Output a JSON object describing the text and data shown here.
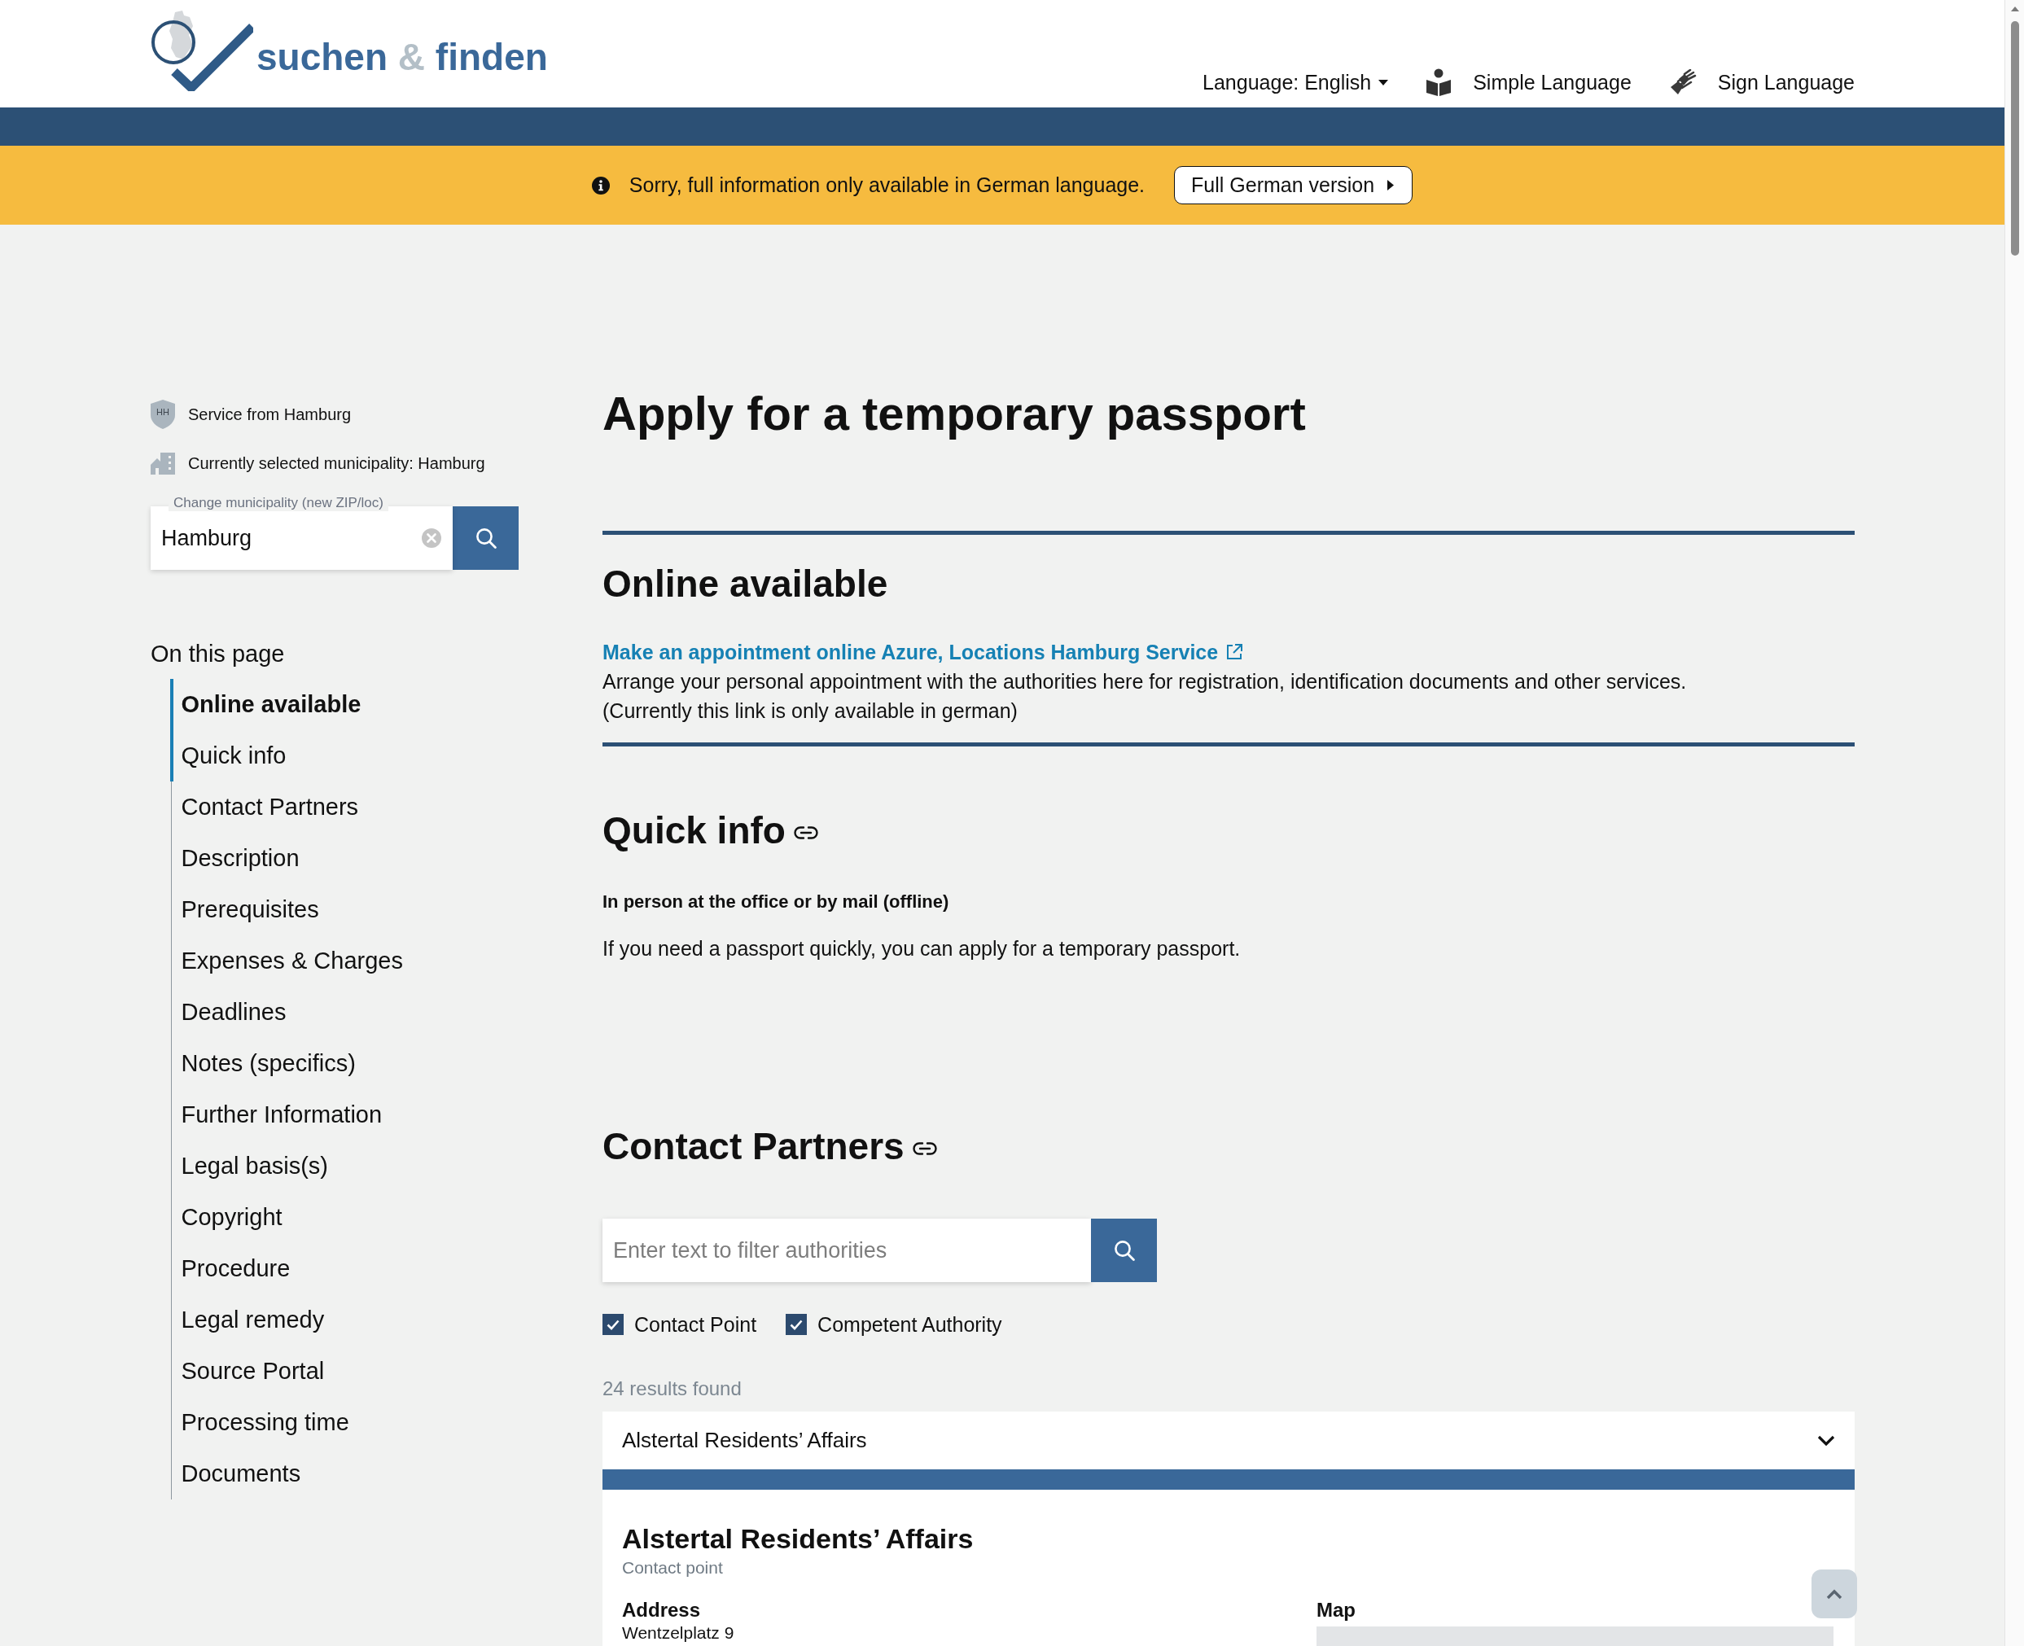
{
  "header": {
    "logo": [
      {
        "text": "suchen",
        "kind": "word"
      },
      {
        "text": "&",
        "kind": "joiner"
      },
      {
        "text": "finden",
        "kind": "word"
      }
    ],
    "language_menu": "Language: English",
    "links": [
      {
        "label": "Simple Language",
        "kind": "simple"
      },
      {
        "label": "Sign Language",
        "kind": "sign"
      }
    ]
  },
  "notice": {
    "text": "Sorry, full information only available in German language.",
    "button": "Full German version"
  },
  "sidebar": {
    "service": {
      "badge": "HH",
      "text": "Service from Hamburg"
    },
    "municipality": "Currently selected municipality: Hamburg",
    "municipality_field": {
      "label": "Change municipality (new ZIP/loc)",
      "value": "Hamburg"
    },
    "toc": {
      "title": "On this page",
      "items": [
        {
          "label": "Online available",
          "selected": true,
          "in_view": true
        },
        {
          "label": "Quick info",
          "selected": false,
          "in_view": true
        },
        {
          "label": "Contact Partners",
          "selected": false,
          "in_view": false
        },
        {
          "label": "Description",
          "selected": false,
          "in_view": false
        },
        {
          "label": "Prerequisites",
          "selected": false,
          "in_view": false
        },
        {
          "label": "Expenses & Charges",
          "selected": false,
          "in_view": false
        },
        {
          "label": "Deadlines",
          "selected": false,
          "in_view": false
        },
        {
          "label": "Notes (specifics)",
          "selected": false,
          "in_view": false
        },
        {
          "label": "Further Information",
          "selected": false,
          "in_view": false
        },
        {
          "label": "Legal basis(s)",
          "selected": false,
          "in_view": false
        },
        {
          "label": "Copyright",
          "selected": false,
          "in_view": false
        },
        {
          "label": "Procedure",
          "selected": false,
          "in_view": false
        },
        {
          "label": "Legal remedy",
          "selected": false,
          "in_view": false
        },
        {
          "label": "Source Portal",
          "selected": false,
          "in_view": false
        },
        {
          "label": "Processing time",
          "selected": false,
          "in_view": false
        },
        {
          "label": "Documents",
          "selected": false,
          "in_view": false
        }
      ]
    }
  },
  "main": {
    "title": "Apply for a temporary passport",
    "online_available": {
      "heading": "Online available",
      "link": "Make an appointment online Azure, Locations Hamburg Service",
      "description": "Arrange your personal appointment with the authorities here for registration, identification documents and other services.",
      "note": "(Currently this link is only available in german)"
    },
    "quick_info": {
      "heading": "Quick info",
      "subheading": "In person at the office or by mail (offline)",
      "text": "If you need a passport quickly, you can apply for a temporary passport."
    },
    "contact_partners": {
      "heading": "Contact Partners",
      "filter": {
        "placeholder": "Enter text to filter authorities"
      },
      "filters": [
        {
          "label": "Contact Point",
          "checked": true
        },
        {
          "label": "Competent Authority",
          "checked": true
        }
      ],
      "results": "24 results found",
      "accordion": {
        "title": "Alstertal Residents’ Affairs",
        "expanded": true,
        "name": "Alstertal Residents’ Affairs",
        "type": "Contact point",
        "address_label": "Address",
        "address": "Wentzelplatz 9",
        "map_label": "Map"
      }
    }
  }
}
